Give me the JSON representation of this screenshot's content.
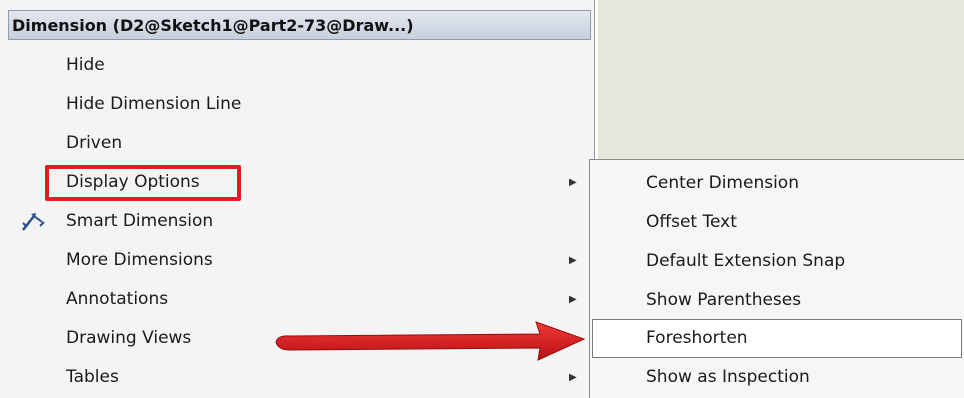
{
  "menu": {
    "title": "Dimension (D2@Sketch1@Part2-73@Draw...)",
    "items": [
      {
        "label": "Hide",
        "submenu": false
      },
      {
        "label": "Hide Dimension Line",
        "submenu": false
      },
      {
        "label": "Driven",
        "submenu": false
      },
      {
        "label": "Display Options",
        "submenu": true
      },
      {
        "label": "Smart Dimension",
        "submenu": false,
        "icon": "smart-dimension-icon"
      },
      {
        "label": "More Dimensions",
        "submenu": true
      },
      {
        "label": "Annotations",
        "submenu": true
      },
      {
        "label": "Drawing Views",
        "submenu": true
      },
      {
        "label": "Tables",
        "submenu": true
      }
    ],
    "arrow_glyph": "▶"
  },
  "submenu": {
    "items": [
      {
        "label": "Center Dimension"
      },
      {
        "label": "Offset Text"
      },
      {
        "label": "Default Extension Snap"
      },
      {
        "label": "Show Parentheses"
      },
      {
        "label": "Foreshorten",
        "hovered": true
      },
      {
        "label": "Show as Inspection"
      }
    ]
  },
  "colors": {
    "highlight_red": "#e21d23",
    "menu_bg": "#f4f4f4",
    "canvas_bg": "#e6e6dc"
  }
}
